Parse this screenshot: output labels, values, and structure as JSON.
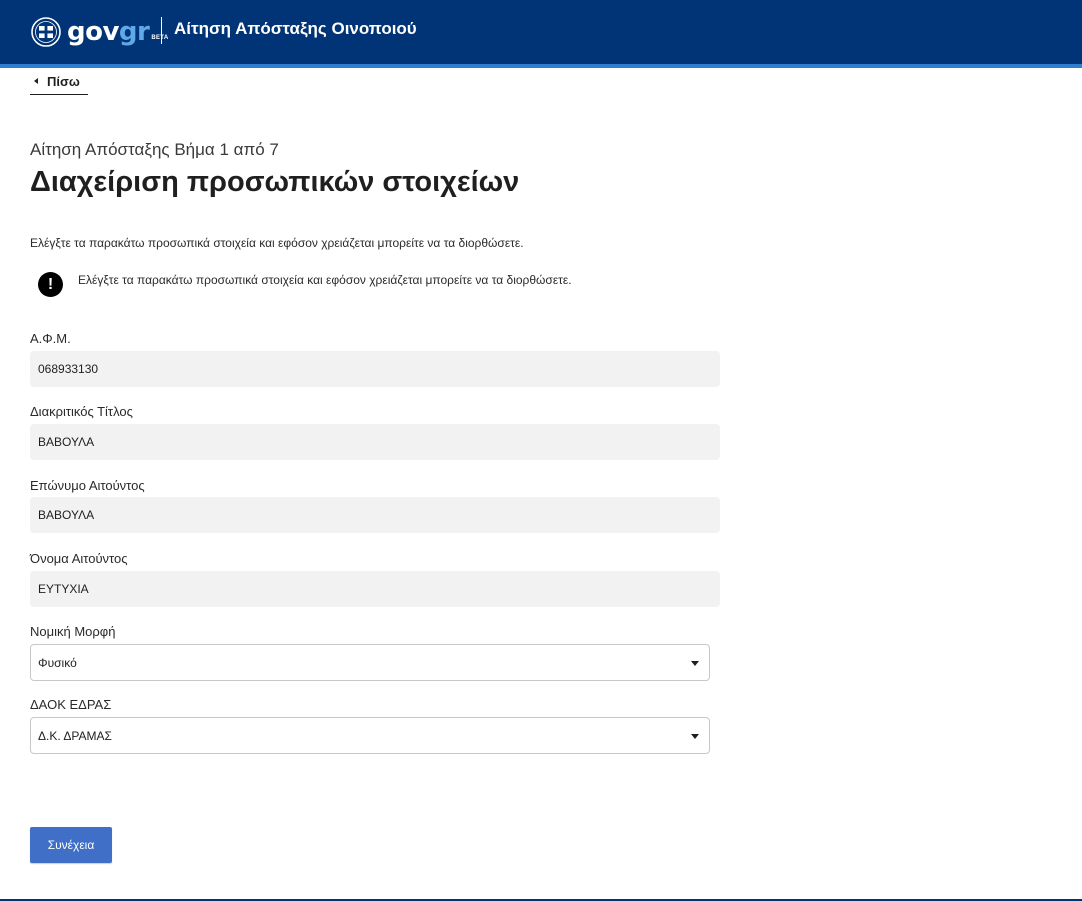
{
  "colors": {
    "header_bg": "#003476",
    "header_accent": "#2f7fd1",
    "primary_button": "#3f6fc7",
    "input_bg": "#f2f2f2"
  },
  "header": {
    "logo": {
      "gov": "gov",
      "gr": "gr",
      "badge": "BETA"
    },
    "title": "Αίτηση Απόσταξης Οινοποιού"
  },
  "nav": {
    "back_label": "Πίσω"
  },
  "page": {
    "step_caption": "Αίτηση Απόσταξης Βήμα 1 από 7",
    "title": "Διαχείριση προσωπικών στοιχείων",
    "intro": "Ελέγξτε τα παρακάτω προσωπικά στοιχεία και εφόσον χρειάζεται μπορείτε να τα διορθώσετε.",
    "notice": {
      "icon": "exclamation-icon",
      "symbol": "!",
      "text": "Ελέγξτε τα παρακάτω προσωπικά στοιχεία και εφόσον χρειάζεται μπορείτε να τα διορθώσετε."
    }
  },
  "form": {
    "afm": {
      "label": "Α.Φ.Μ.",
      "value": "068933130"
    },
    "distinctive_title": {
      "label": "Διακριτικός Τίτλος",
      "value": "ΒΑΒΟΥΛΑ"
    },
    "surname": {
      "label": "Επώνυμο Αιτούντος",
      "value": "ΒΑΒΟΥΛΑ"
    },
    "first_name": {
      "label": "Όνομα Αιτούντος",
      "value": "ΕΥΤΥΧΙΑ"
    },
    "legal_form": {
      "label": "Νομική Μορφή",
      "selected": "Φυσικό"
    },
    "daok": {
      "label": "ΔΑΟΚ ΕΔΡΑΣ",
      "selected": "Δ.Κ. ΔΡΑΜΑΣ"
    }
  },
  "actions": {
    "continue_label": "Συνέχεια"
  }
}
